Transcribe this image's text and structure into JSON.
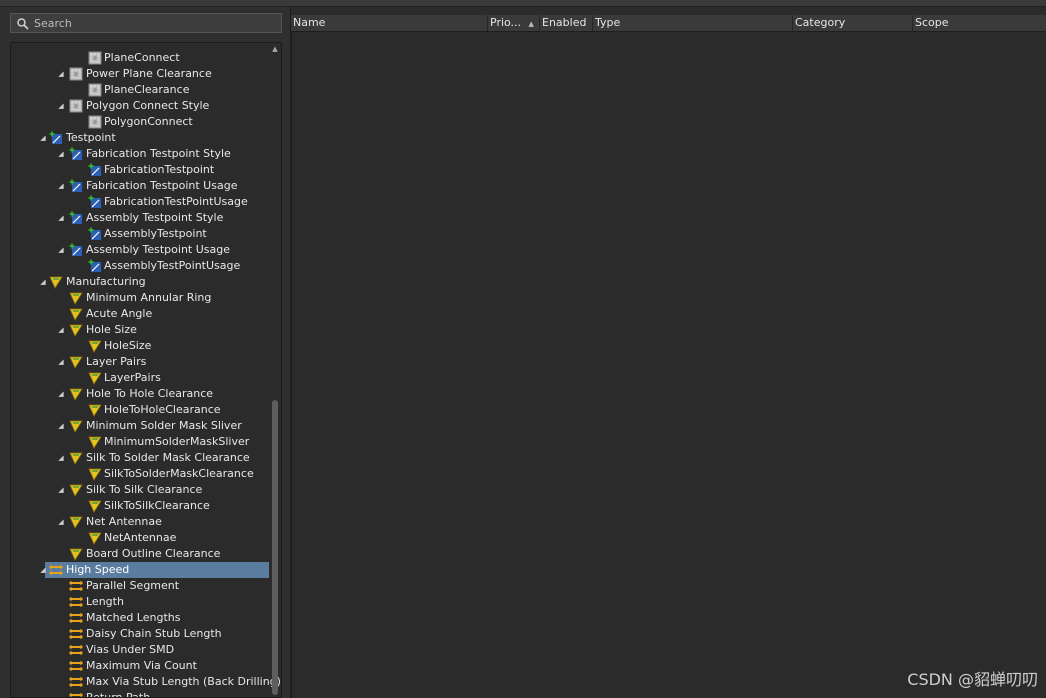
{
  "search": {
    "placeholder": "Search"
  },
  "tree": {
    "items": [
      {
        "label": "PlaneConnect",
        "icon": "plane-connect-icon",
        "expander": ""
      },
      {
        "label": "Power Plane Clearance",
        "icon": "plane-clearance-icon",
        "expander": "◢"
      },
      {
        "label": "PlaneClearance",
        "icon": "plane-clearance-icon",
        "expander": ""
      },
      {
        "label": "Polygon Connect Style",
        "icon": "polygon-connect-icon",
        "expander": "◢"
      },
      {
        "label": "PolygonConnect",
        "icon": "polygon-connect-icon",
        "expander": ""
      },
      {
        "label": "Testpoint",
        "icon": "testpoint-icon",
        "expander": "◢"
      },
      {
        "label": "Fabrication Testpoint Style",
        "icon": "testpoint-icon",
        "expander": "◢"
      },
      {
        "label": "FabricationTestpoint",
        "icon": "testpoint-icon",
        "expander": ""
      },
      {
        "label": "Fabrication Testpoint Usage",
        "icon": "testpoint-icon",
        "expander": "◢"
      },
      {
        "label": "FabricationTestPointUsage",
        "icon": "testpoint-icon",
        "expander": ""
      },
      {
        "label": "Assembly Testpoint Style",
        "icon": "testpoint-icon",
        "expander": "◢"
      },
      {
        "label": "AssemblyTestpoint",
        "icon": "testpoint-icon",
        "expander": ""
      },
      {
        "label": "Assembly Testpoint Usage",
        "icon": "testpoint-icon",
        "expander": "◢"
      },
      {
        "label": "AssemblyTestPointUsage",
        "icon": "testpoint-icon",
        "expander": ""
      },
      {
        "label": "Manufacturing",
        "icon": "manufacturing-icon",
        "expander": "◢"
      },
      {
        "label": "Minimum Annular Ring",
        "icon": "manufacturing-icon",
        "expander": ""
      },
      {
        "label": "Acute Angle",
        "icon": "manufacturing-icon",
        "expander": ""
      },
      {
        "label": "Hole Size",
        "icon": "manufacturing-icon",
        "expander": "◢"
      },
      {
        "label": "HoleSize",
        "icon": "manufacturing-icon",
        "expander": ""
      },
      {
        "label": "Layer Pairs",
        "icon": "manufacturing-icon",
        "expander": "◢"
      },
      {
        "label": "LayerPairs",
        "icon": "manufacturing-icon",
        "expander": ""
      },
      {
        "label": "Hole To Hole Clearance",
        "icon": "manufacturing-icon",
        "expander": "◢"
      },
      {
        "label": "HoleToHoleClearance",
        "icon": "manufacturing-icon",
        "expander": ""
      },
      {
        "label": "Minimum Solder Mask Sliver",
        "icon": "manufacturing-icon",
        "expander": "◢"
      },
      {
        "label": "MinimumSolderMaskSliver",
        "icon": "manufacturing-icon",
        "expander": ""
      },
      {
        "label": "Silk To Solder Mask Clearance",
        "icon": "manufacturing-icon",
        "expander": "◢"
      },
      {
        "label": "SilkToSolderMaskClearance",
        "icon": "manufacturing-icon",
        "expander": ""
      },
      {
        "label": "Silk To Silk Clearance",
        "icon": "manufacturing-icon",
        "expander": "◢"
      },
      {
        "label": "SilkToSilkClearance",
        "icon": "manufacturing-icon",
        "expander": ""
      },
      {
        "label": "Net Antennae",
        "icon": "manufacturing-icon",
        "expander": "◢"
      },
      {
        "label": "NetAntennae",
        "icon": "manufacturing-icon",
        "expander": ""
      },
      {
        "label": "Board Outline Clearance",
        "icon": "manufacturing-icon",
        "expander": ""
      },
      {
        "label": "High Speed",
        "icon": "high-speed-icon",
        "expander": "◢",
        "selected": true
      },
      {
        "label": "Parallel Segment",
        "icon": "high-speed-icon",
        "expander": ""
      },
      {
        "label": "Length",
        "icon": "high-speed-icon",
        "expander": ""
      },
      {
        "label": "Matched Lengths",
        "icon": "high-speed-icon",
        "expander": ""
      },
      {
        "label": "Daisy Chain Stub Length",
        "icon": "high-speed-icon",
        "expander": ""
      },
      {
        "label": "Vias Under SMD",
        "icon": "high-speed-icon",
        "expander": ""
      },
      {
        "label": "Maximum Via Count",
        "icon": "high-speed-icon",
        "expander": ""
      },
      {
        "label": "Max Via Stub Length (Back Drilling)",
        "icon": "high-speed-icon",
        "expander": ""
      },
      {
        "label": "Return Path",
        "icon": "high-speed-icon",
        "expander": ""
      }
    ]
  },
  "grid": {
    "columns": [
      "Name",
      "Prio...",
      "Enabled",
      "Type",
      "Category",
      "Scope"
    ],
    "sort_indicator": "▲"
  },
  "watermark": "CSDN @貂蝉叨叨",
  "colors": {
    "selection": "#5a7c9e",
    "background": "#2b2b2b",
    "header": "#3a3a3a"
  }
}
